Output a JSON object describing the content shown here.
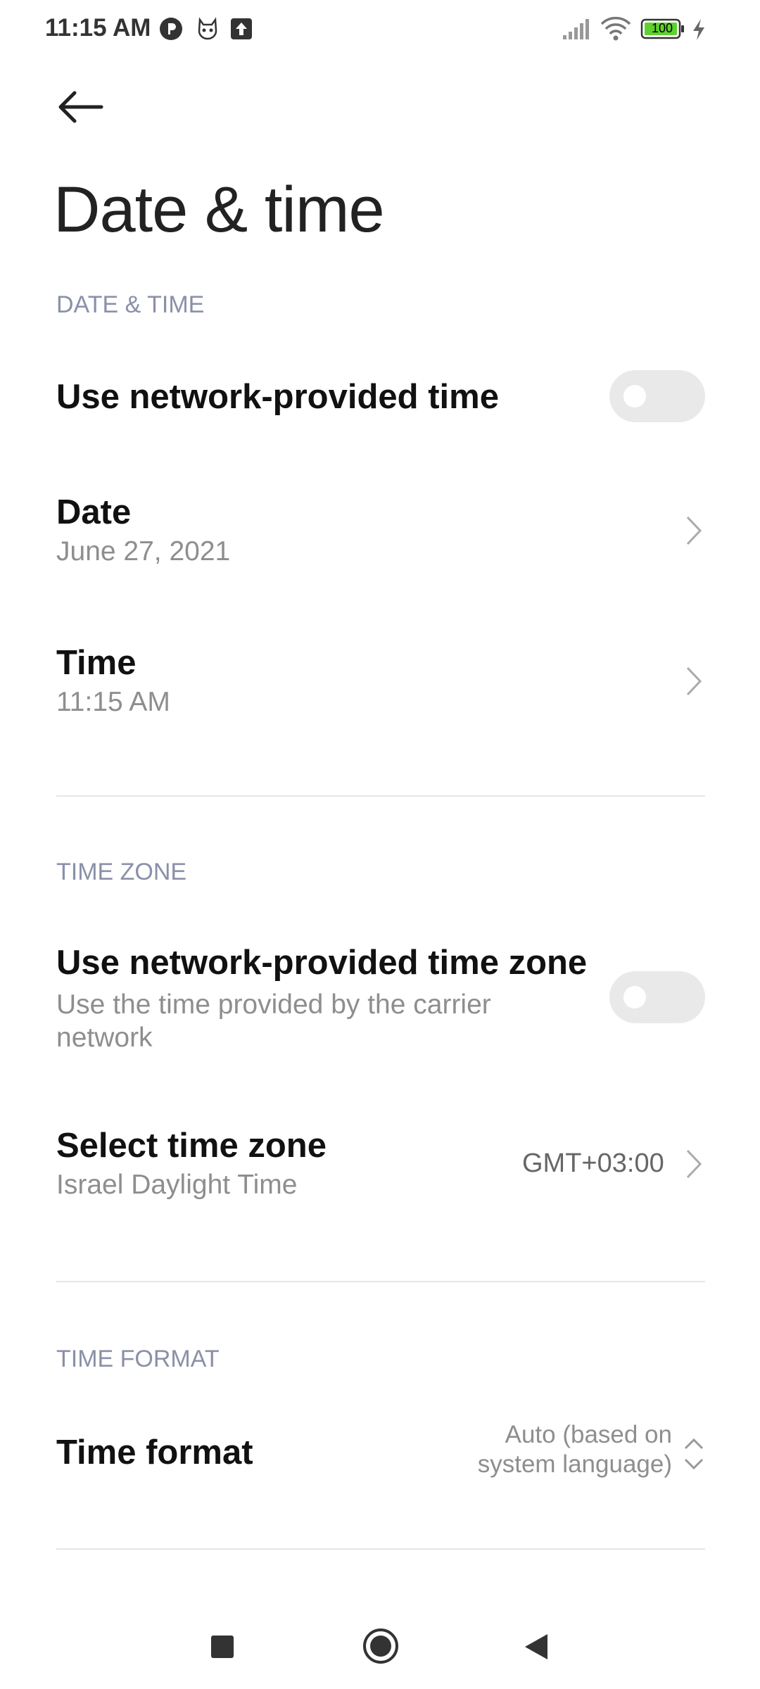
{
  "status_bar": {
    "time": "11:15 AM",
    "battery_level": "100"
  },
  "header": {
    "title": "Date & time"
  },
  "sections": {
    "date_time": {
      "header": "DATE & TIME",
      "network_time": {
        "label": "Use network-provided time",
        "enabled": false
      },
      "date": {
        "label": "Date",
        "value": "June 27, 2021"
      },
      "time": {
        "label": "Time",
        "value": "11:15 AM"
      }
    },
    "time_zone": {
      "header": "TIME ZONE",
      "network_zone": {
        "label": "Use network-provided time zone",
        "description": "Use the time provided by the carrier network",
        "enabled": false
      },
      "select_zone": {
        "label": "Select time zone",
        "value": "Israel Daylight Time",
        "offset": "GMT+03:00"
      }
    },
    "time_format": {
      "header": "TIME FORMAT",
      "format": {
        "label": "Time format",
        "value": "Auto (based on system language)"
      }
    }
  },
  "colors": {
    "section_header": "#8a90a8",
    "toggle_off": "#e9e9e9",
    "battery_fill": "#5fd12f"
  }
}
